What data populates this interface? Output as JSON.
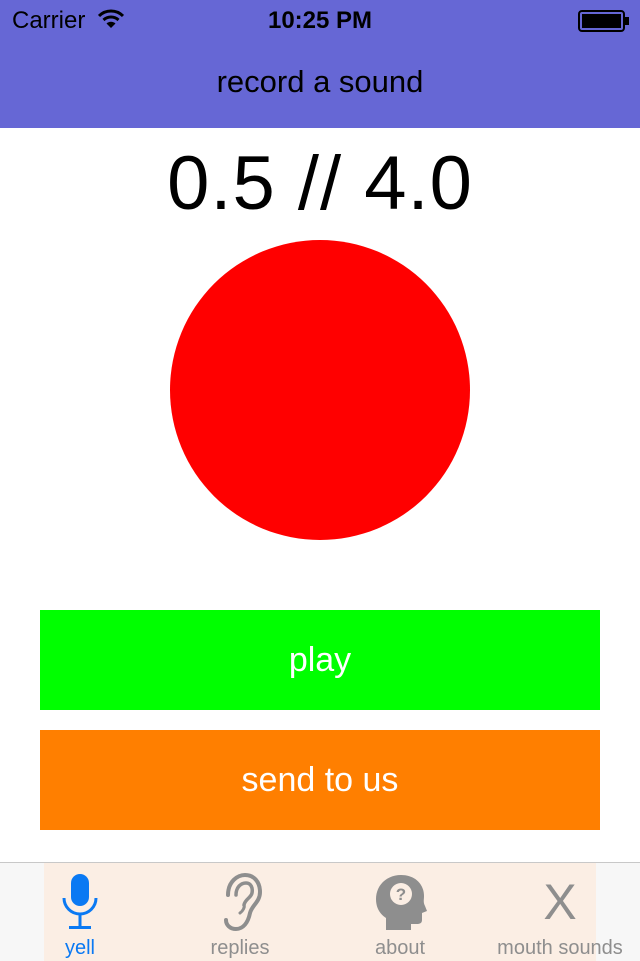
{
  "status_bar": {
    "carrier": "Carrier",
    "time": "10:25 PM"
  },
  "header": {
    "title": "record a sound",
    "background": "#6667d5"
  },
  "recorder": {
    "timer": "0.5 // 4.0",
    "record_color": "#ff0000"
  },
  "buttons": {
    "play_label": "play",
    "play_color": "#00ff00",
    "send_label": "send to us",
    "send_color": "#ff7f00"
  },
  "tabs": [
    {
      "label": "yell",
      "icon": "microphone-icon",
      "active": true
    },
    {
      "label": "replies",
      "icon": "ear-icon",
      "active": false
    },
    {
      "label": "about",
      "icon": "head-question-icon",
      "active": false
    },
    {
      "label": "mouth sounds",
      "icon": "x-icon",
      "icon_text": "X",
      "active": false
    }
  ],
  "colors": {
    "tab_active": "#0a79f3",
    "tab_inactive": "#8e8e8e"
  }
}
